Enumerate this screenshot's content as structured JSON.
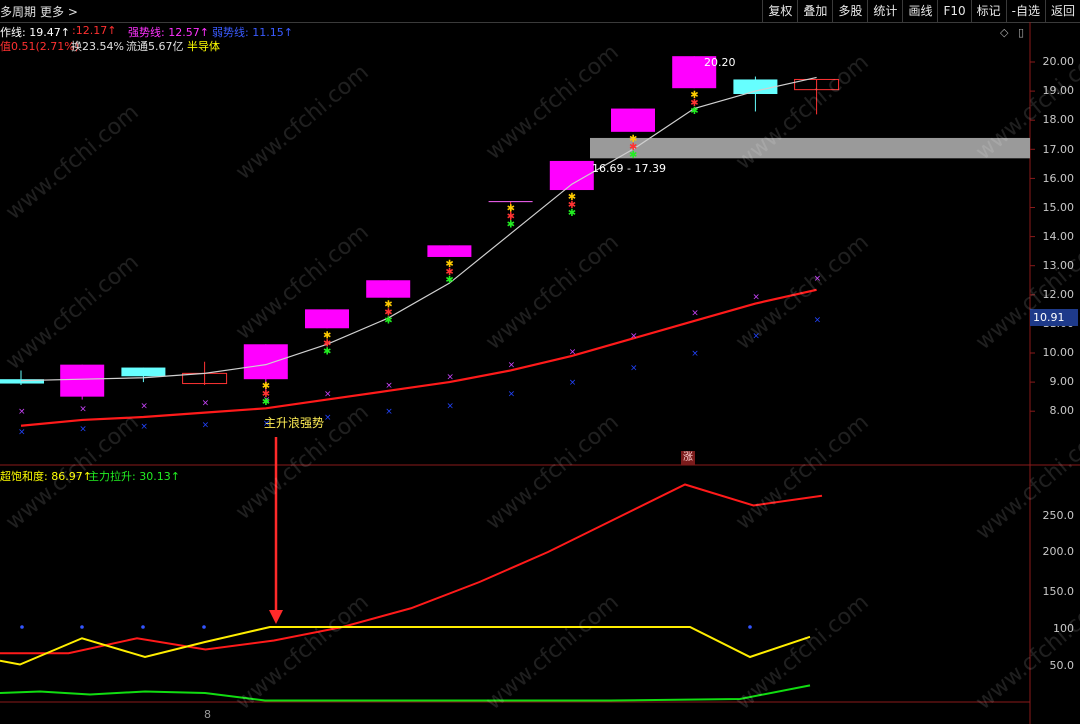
{
  "toolbar": {
    "period_label": "多周期",
    "more_label": "更多 >",
    "menu": [
      "复权",
      "叠加",
      "多股",
      "统计",
      "画线",
      "F10",
      "标记",
      "-自选",
      "返回"
    ]
  },
  "indicators": {
    "line1": [
      {
        "text": "作线: 19.47↑",
        "color": "#ffffff"
      },
      {
        "text": ":12.17↑",
        "color": "#ff3030"
      },
      {
        "text": "强势线: 12.57↑",
        "color": "#ff33ff"
      },
      {
        "text": "弱势线: 11.15↑",
        "color": "#3a5bff"
      }
    ],
    "line2": [
      {
        "text": "值0.51(2.71%)",
        "color": "#ff3030"
      },
      {
        "text": "换23.54%",
        "color": "#e0e0e0"
      },
      {
        "text": "流通5.67亿",
        "color": "#e0e0e0"
      },
      {
        "text": "半导体",
        "color": "#ffff00"
      }
    ],
    "sub": [
      {
        "text": "超饱和度: 86.97↑",
        "color": "#ffff00"
      },
      {
        "text": "主力拉升: 30.13↑",
        "color": "#22ee22"
      }
    ]
  },
  "right_icons": [
    "◇",
    "▯"
  ],
  "price_axis": [
    "20.00",
    "19.00",
    "18.00",
    "17.00",
    "16.00",
    "15.00",
    "14.00",
    "13.00",
    "12.00",
    "11.00",
    "10.00",
    "9.00",
    "8.00"
  ],
  "sub_axis": [
    "250.0",
    "200.0",
    "150.0",
    "100",
    "50.0"
  ],
  "current_price_tag": "10.91",
  "annotations": {
    "peak": "20.20",
    "zone": "16.69 - 17.39",
    "signal": "主升浪强势",
    "zhang": "涨",
    "bottom_tick": "8"
  },
  "watermark": "www.cfchi.com",
  "colors": {
    "up_candle": "#ff00ff",
    "down_candle": "#66ffff",
    "hollow_candle": "#ff3333",
    "ma_white": "#d0d0d0",
    "ma_red": "#ff1a1a",
    "sub_red": "#ff1a1a",
    "sub_yellow": "#ffee00",
    "sub_green": "#11dd11",
    "zone_fill": "#9a9a9a"
  },
  "candles": [
    {
      "o": 9.1,
      "h": 9.4,
      "l": 8.9,
      "c": 8.95,
      "type": "down"
    },
    {
      "o": 8.5,
      "h": 9.6,
      "l": 8.4,
      "c": 9.6,
      "type": "up"
    },
    {
      "o": 9.5,
      "h": 9.5,
      "l": 9.0,
      "c": 9.2,
      "type": "down"
    },
    {
      "o": 8.95,
      "h": 9.7,
      "l": 8.9,
      "c": 9.3,
      "type": "hollow"
    },
    {
      "o": 9.1,
      "h": 10.3,
      "l": 8.6,
      "c": 10.3,
      "type": "up"
    },
    {
      "o": 10.85,
      "h": 11.5,
      "l": 10.85,
      "c": 11.5,
      "type": "up"
    },
    {
      "o": 11.9,
      "h": 12.5,
      "l": 11.9,
      "c": 12.5,
      "type": "up"
    },
    {
      "o": 13.3,
      "h": 13.7,
      "l": 13.3,
      "c": 13.7,
      "type": "up"
    },
    {
      "o": 15.2,
      "h": 15.2,
      "l": 14.5,
      "c": 15.2,
      "type": "hollow_line"
    },
    {
      "o": 15.6,
      "h": 16.6,
      "l": 15.6,
      "c": 16.6,
      "type": "up"
    },
    {
      "o": 17.6,
      "h": 18.4,
      "l": 17.6,
      "c": 18.4,
      "type": "up"
    },
    {
      "o": 19.1,
      "h": 20.2,
      "l": 19.1,
      "c": 20.2,
      "type": "up"
    },
    {
      "o": 19.4,
      "h": 19.5,
      "l": 18.3,
      "c": 18.9,
      "type": "down"
    },
    {
      "o": 19.4,
      "h": 19.4,
      "l": 18.2,
      "c": 19.05,
      "type": "hollow"
    }
  ],
  "ma_white": [
    9.05,
    9.1,
    9.15,
    9.3,
    9.6,
    10.3,
    11.2,
    12.4,
    14.1,
    15.8,
    17.0,
    18.4,
    19.0,
    19.47
  ],
  "ma_red": [
    7.5,
    7.7,
    7.8,
    7.95,
    8.1,
    8.4,
    8.7,
    9.0,
    9.4,
    9.9,
    10.5,
    11.1,
    11.7,
    12.17
  ],
  "dots_magenta": [
    8.0,
    8.1,
    8.2,
    8.3,
    8.4,
    8.6,
    8.9,
    9.2,
    9.6,
    10.05,
    10.6,
    11.4,
    11.95,
    12.57
  ],
  "dots_blue": [
    7.3,
    7.4,
    7.5,
    7.55,
    7.6,
    7.8,
    8.0,
    8.2,
    8.6,
    9.0,
    9.5,
    10.0,
    10.6,
    11.15
  ],
  "sub_red": [
    65,
    65,
    85,
    70,
    82,
    100,
    125,
    160,
    200,
    245,
    290,
    262,
    275
  ],
  "sub_yellow": [
    55,
    50,
    85,
    60,
    80,
    100,
    100,
    100,
    100,
    100,
    100,
    100,
    60,
    86.97
  ],
  "sub_green": [
    20,
    22,
    18,
    22,
    20,
    10,
    10,
    10,
    10,
    10,
    10,
    12,
    30.13
  ],
  "sub_blue_dots": [
    100,
    100,
    100,
    100,
    100
  ]
}
